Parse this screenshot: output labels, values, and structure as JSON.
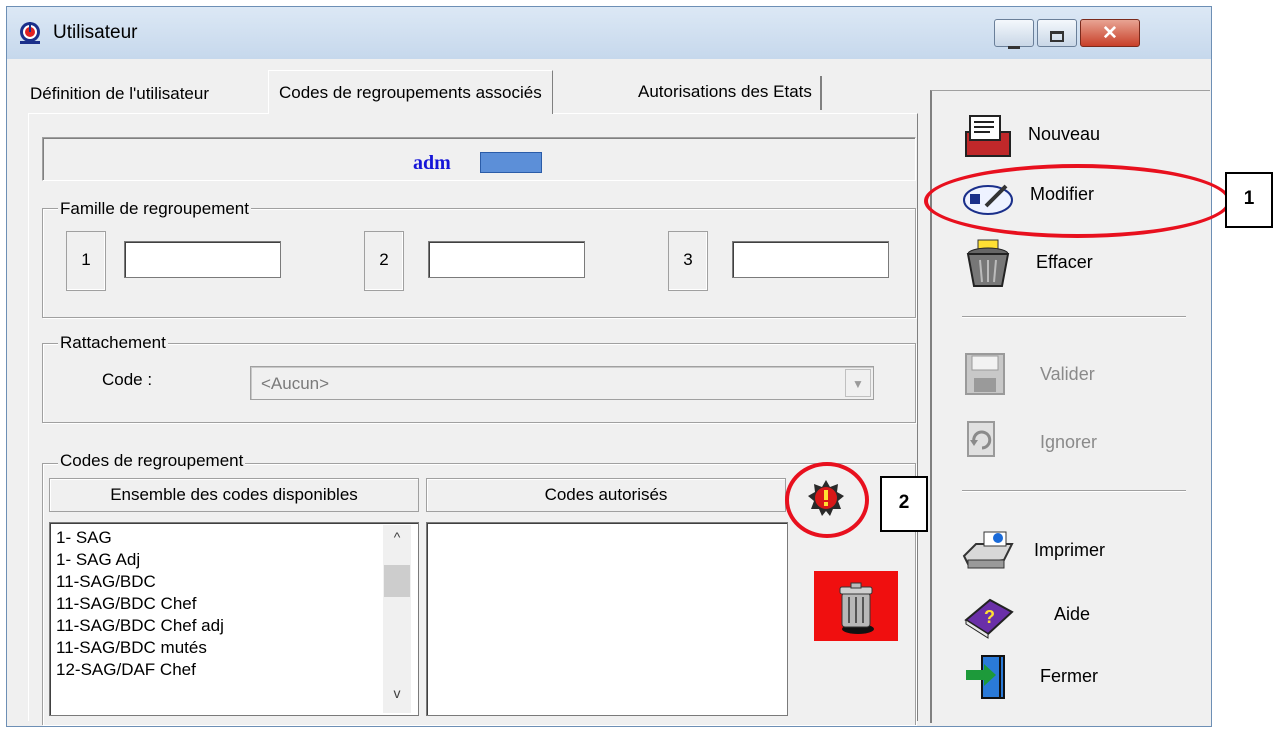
{
  "window": {
    "title": "Utilisateur"
  },
  "tabs": [
    {
      "label": "Définition de l'utilisateur"
    },
    {
      "label": "Codes de regroupements associés"
    },
    {
      "label": "Autorisations des Etats"
    }
  ],
  "user": {
    "name": "adm"
  },
  "famille": {
    "legend": "Famille de regroupement",
    "fields": [
      {
        "num": "1",
        "value": ""
      },
      {
        "num": "2",
        "value": ""
      },
      {
        "num": "3",
        "value": ""
      }
    ]
  },
  "rattachement": {
    "legend": "Rattachement",
    "code_label": "Code :",
    "code_value": "<Aucun>"
  },
  "codes": {
    "legend": "Codes de regroupement",
    "available_header": "Ensemble des codes disponibles",
    "authorized_header": "Codes autorisés",
    "available_items": [
      "1- SAG",
      "1- SAG Adj",
      "11-SAG/BDC",
      "11-SAG/BDC Chef",
      "11-SAG/BDC Chef adj",
      "11-SAG/BDC mutés",
      "12-SAG/DAF Chef"
    ],
    "authorized_items": []
  },
  "toolbar": {
    "nouveau": "Nouveau",
    "modifier": "Modifier",
    "effacer": "Effacer",
    "valider": "Valider",
    "ignorer": "Ignorer",
    "imprimer": "Imprimer",
    "aide": "Aide",
    "fermer": "Fermer"
  },
  "callouts": {
    "one": "1",
    "two": "2"
  },
  "colors": {
    "accent_red": "#e8101e",
    "user_name_blue": "#1515d8",
    "delete_bg": "#f00f0f"
  },
  "icons": [
    "app-icon",
    "minimize-icon",
    "maximize-icon",
    "close-icon",
    "warning-icon",
    "trash-icon",
    "new-card-icon",
    "edit-icon",
    "folder-trash-icon",
    "save-icon",
    "undo-icon",
    "printer-icon",
    "help-book-icon",
    "exit-door-icon"
  ]
}
